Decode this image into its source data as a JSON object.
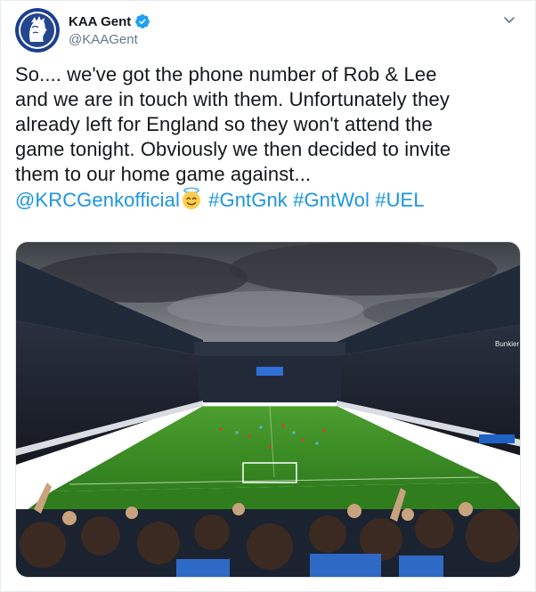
{
  "author": {
    "display_name": "KAA Gent",
    "handle": "@KAAGent",
    "verified": true,
    "avatar_icon": "kaa-gent-crest-icon"
  },
  "tweet": {
    "text_lines": [
      "So.... we've got the phone number of Rob & Lee",
      "and we are in touch with them. Unfortunately they",
      "already left for England so they won't attend the",
      "game tonight. Obviously we then decided to invite",
      "them to our home game against..."
    ],
    "mention": "@KRCGenkofficial",
    "emoji": "smiling-face-with-halo",
    "hashtags": [
      "#GntGnk",
      "#GntWol",
      "#UEL"
    ]
  },
  "media": {
    "type": "photo",
    "board_text": "Bunkier"
  },
  "colors": {
    "link": "#1b95e0",
    "verified": "#1da1f2",
    "text": "#14171a",
    "secondary": "#657786"
  }
}
